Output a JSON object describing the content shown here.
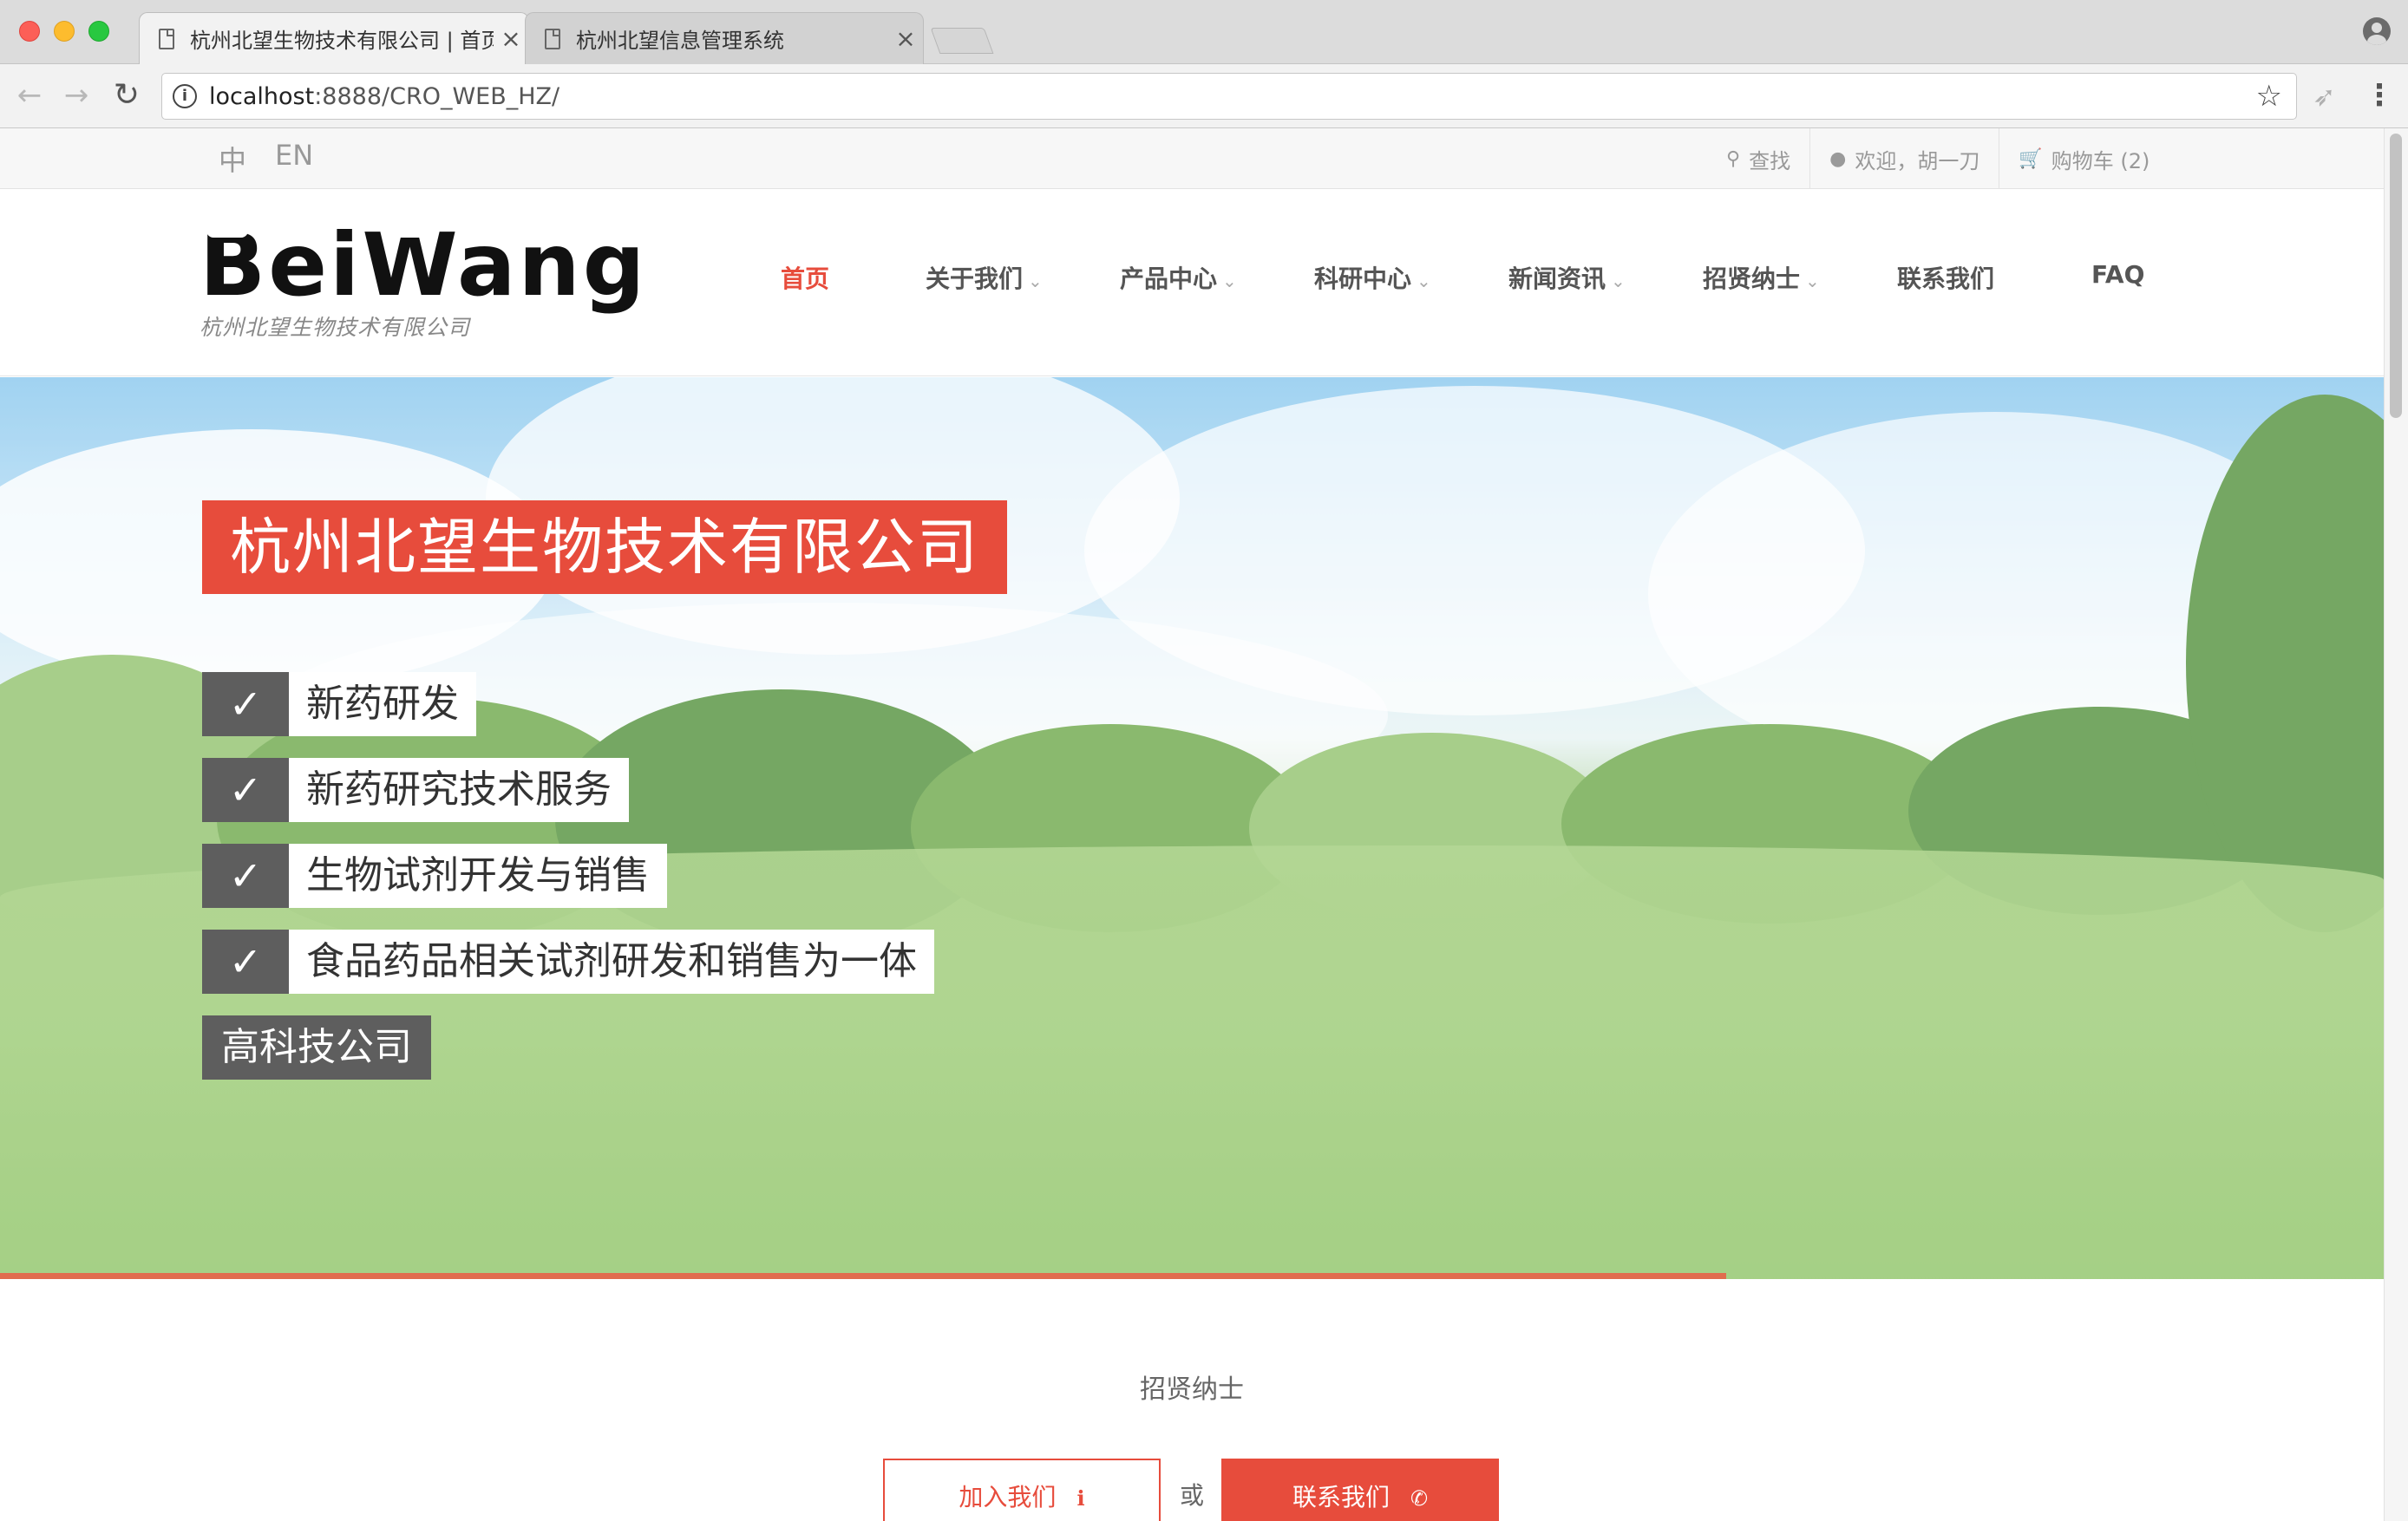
{
  "browser": {
    "tabs": [
      {
        "title": "杭州北望生物技术有限公司 | 首页",
        "active": true
      },
      {
        "title": "杭州北望信息管理系统",
        "active": false
      }
    ],
    "url_host": "localhost",
    "url_path": ":8888/CRO_WEB_HZ/"
  },
  "topbar": {
    "lang_zh": "中",
    "lang_en": "EN",
    "search_label": "查找",
    "welcome_label": "欢迎，胡一刀",
    "cart_label": "购物车 (2)"
  },
  "header": {
    "logo_text": "BeiWang",
    "logo_sub": "杭州北望生物技术有限公司",
    "menu": [
      {
        "label": "首页",
        "active": true,
        "has_dropdown": false
      },
      {
        "label": "关于我们",
        "active": false,
        "has_dropdown": true
      },
      {
        "label": "产品中心",
        "active": false,
        "has_dropdown": true
      },
      {
        "label": "科研中心",
        "active": false,
        "has_dropdown": true
      },
      {
        "label": "新闻资讯",
        "active": false,
        "has_dropdown": true
      },
      {
        "label": "招贤纳士",
        "active": false,
        "has_dropdown": true
      },
      {
        "label": "联系我们",
        "active": false,
        "has_dropdown": false
      },
      {
        "label": "FAQ",
        "active": false,
        "has_dropdown": false
      }
    ]
  },
  "hero": {
    "title": "杭州北望生物技术有限公司",
    "features": [
      "新药研发",
      "新药研究技术服务",
      "生物试剂开发与销售",
      "食品药品相关试剂研发和销售为一体"
    ],
    "tag": "高科技公司",
    "check_glyph": "✓"
  },
  "cta": {
    "section_title": "招贤纳士",
    "join_label": "加入我们",
    "or_text": "或",
    "contact_label": "联系我们"
  },
  "colors": {
    "accent": "#e74c3c",
    "dark_box": "#5e5e5e"
  }
}
